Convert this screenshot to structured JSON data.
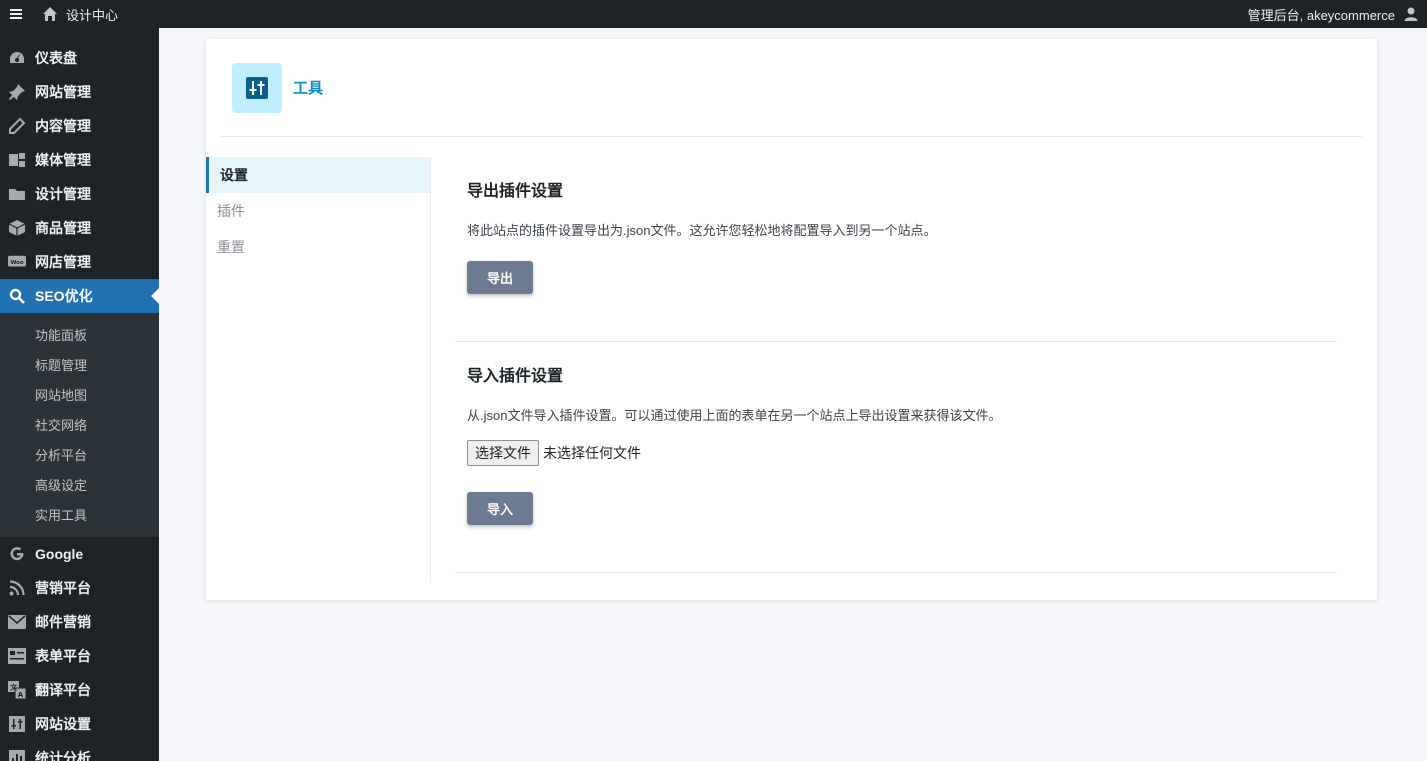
{
  "topbar": {
    "site_name": "设计中心",
    "greeting": "管理后台, akeycommerce"
  },
  "sidebar": {
    "items": [
      {
        "label": "仪表盘",
        "icon": "dashboard-icon"
      },
      {
        "label": "网站管理",
        "icon": "pin-icon"
      },
      {
        "label": "内容管理",
        "icon": "pencil-icon"
      },
      {
        "label": "媒体管理",
        "icon": "media-icon"
      },
      {
        "label": "设计管理",
        "icon": "folder-icon"
      },
      {
        "label": "商品管理",
        "icon": "box-icon"
      },
      {
        "label": "网店管理",
        "icon": "woo-icon"
      },
      {
        "label": "SEO优化",
        "icon": "search-icon",
        "active": true
      }
    ],
    "submenu": [
      "功能面板",
      "标题管理",
      "网站地图",
      "社交网络",
      "分析平台",
      "高级设定",
      "实用工具"
    ],
    "items_after": [
      {
        "label": "Google",
        "icon": "google-icon"
      },
      {
        "label": "营销平台",
        "icon": "rss-icon"
      },
      {
        "label": "邮件营销",
        "icon": "mail-icon"
      },
      {
        "label": "表单平台",
        "icon": "form-icon"
      },
      {
        "label": "翻译平台",
        "icon": "translate-icon"
      },
      {
        "label": "网站设置",
        "icon": "settings-icon"
      },
      {
        "label": "统计分析",
        "icon": "stats-icon"
      }
    ]
  },
  "card": {
    "title": "工具",
    "tabs": [
      "设置",
      "插件",
      "重置"
    ],
    "export": {
      "heading": "导出插件设置",
      "description": "将此站点的插件设置导出为.json文件。这允许您轻松地将配置导入到另一个站点。",
      "button": "导出"
    },
    "import": {
      "heading": "导入插件设置",
      "description": "从.json文件导入插件设置。可以通过使用上面的表单在另一个站点上导出设置来获得该文件。",
      "file_button": "选择文件",
      "file_status": "未选择任何文件",
      "button": "导入"
    }
  },
  "colors": {
    "sidebar_bg": "#1d2327",
    "active_menu": "#2271b1",
    "title_accent": "#0a8ec2",
    "button_bg": "#6c7a92"
  }
}
